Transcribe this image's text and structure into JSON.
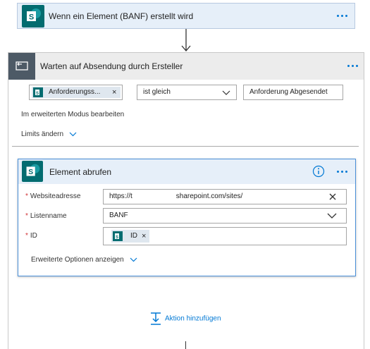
{
  "trigger": {
    "title": "Wenn ein Element (BANF) erstellt wird"
  },
  "wait": {
    "title": "Warten auf Absendung durch Ersteller",
    "condition": {
      "left_token": "Anforderungss...",
      "operator": "ist gleich",
      "right_value": "Anforderung Abgesendet"
    },
    "advanced_mode_link": "Im erweiterten Modus bearbeiten",
    "limits_link": "Limits ändern"
  },
  "get_item": {
    "title": "Element abrufen",
    "fields": {
      "site_label": "Websiteadresse",
      "site_value_prefix": "https://t",
      "site_value_middle": "sharepoint.com/sites/",
      "list_label": "Listenname",
      "list_value": "BANF",
      "id_label": "ID",
      "id_token": "ID"
    },
    "advanced_options": "Erweiterte Optionen anzeigen"
  },
  "add_action": "Aktion hinzufügen",
  "required_marker": "*",
  "remove_glyph": "×",
  "colors": {
    "accent": "#0078d4",
    "sharepoint": "#036c70",
    "header_bg": "#e6eff9",
    "required": "#d13438"
  },
  "icons": [
    "sharepoint-icon",
    "wait-icon",
    "more-icon",
    "info-icon",
    "chevron-down-icon",
    "clear-icon",
    "add-action-icon",
    "arrow-down-icon"
  ]
}
